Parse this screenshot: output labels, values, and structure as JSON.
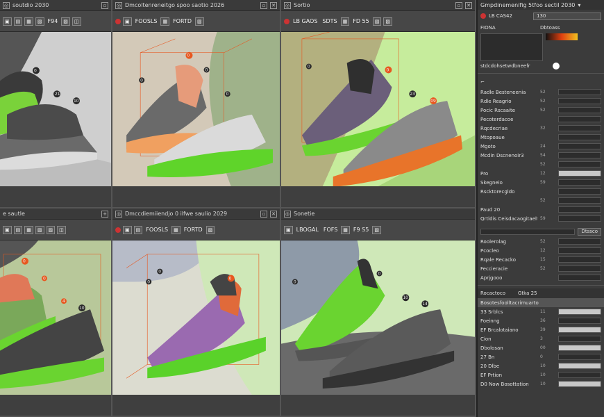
{
  "viewports": [
    {
      "title": "soutdio 2030",
      "tools": [
        "",
        "",
        "",
        "",
        "F94",
        "",
        "",
        ""
      ]
    },
    {
      "title": "Dmcoltenreneitgo spoo  saotio 2026",
      "tools": [
        "",
        "FOOSLS",
        "",
        "FORTD",
        ""
      ]
    },
    {
      "title": "Sortio",
      "tools": [
        "",
        "LB GAOS",
        "",
        "SDTS",
        "",
        "FD 55",
        "",
        ""
      ]
    },
    {
      "title": "e sautle",
      "tools": [
        "",
        "",
        "",
        "",
        "",
        "",
        "",
        ""
      ]
    },
    {
      "title": "Dmccdiemiiendjo 0 ilfwe  saulio 2029",
      "tools": [
        "",
        "",
        "",
        "FOOSLS",
        "",
        "FORTD",
        ""
      ]
    },
    {
      "title": "Sonetie",
      "tools": [
        "",
        "LBOGAL",
        "",
        "FOFS",
        "",
        "F9 S5",
        "",
        ""
      ]
    }
  ],
  "markers": {
    "v1": [
      "0",
      "21",
      "10"
    ],
    "v2": [
      "0",
      "0",
      "0",
      "0"
    ],
    "v3": [
      "0",
      "0",
      "23",
      "09"
    ],
    "v4": [
      "0",
      "0",
      "4",
      "10"
    ],
    "v5": [
      "0",
      "0",
      "0"
    ],
    "v6": [
      "0",
      "0",
      "10",
      "14"
    ]
  },
  "panel": {
    "title": "Gmpdinemenifig 5tfoo  sectil 2030",
    "top_label_1": "LB CAS42",
    "top_value": "130",
    "top_label_2": "FIONA",
    "top_label_3": "Dbtoass",
    "row_small": "stdcdohsetwdbneefr",
    "section1": [
      {
        "label": "Radle Besteneenia",
        "val": "52"
      },
      {
        "label": "Rdle Reagrio",
        "val": "52"
      },
      {
        "label": "Pocic Rscaaite",
        "val": "52"
      },
      {
        "label": "Pecoterdacoe",
        "val": ""
      },
      {
        "label": "Rqcdecriae",
        "val": "32"
      },
      {
        "label": "Mtopoaue",
        "val": ""
      },
      {
        "label": "Mgoto",
        "val": "24"
      },
      {
        "label": "Mcdin Dscnenoir3",
        "val": "54"
      },
      {
        "label": "",
        "val": "52"
      },
      {
        "label": "Pro",
        "val": "12"
      },
      {
        "label": "Skegneio",
        "val": "59"
      },
      {
        "label": "Rscktorecgldo",
        "val": ""
      },
      {
        "label": "",
        "val": "52"
      },
      {
        "label": "Paud 20",
        "val": ""
      },
      {
        "label": "Qrtldis Ceisdacaogitaelte",
        "val": "59"
      }
    ],
    "bar_label": "Dtssco",
    "section2": [
      {
        "label": "Roolerolag",
        "val": "52"
      },
      {
        "label": "Pcocleo",
        "val": "12"
      },
      {
        "label": "Rqale Recacko",
        "val": "15"
      },
      {
        "label": "Feccieracie",
        "val": "52"
      },
      {
        "label": "Aprjgooo",
        "val": ""
      }
    ],
    "table_header_1": "Rocactoco",
    "table_header_2": "Gtka 25",
    "table_title_row": "Bosotesfoolltacrimuarto",
    "table": [
      {
        "label": "33 Srblcs",
        "val": "11"
      },
      {
        "label": "Foeinng",
        "val": "36"
      },
      {
        "label": "EF Brcalotaiano",
        "val": "39"
      },
      {
        "label": "Cion",
        "val": "3"
      },
      {
        "label": "Dbolosan",
        "val": "00"
      },
      {
        "label": "27 Bn",
        "val": "0"
      },
      {
        "label": "20 Dlbe",
        "val": "10"
      },
      {
        "label": "EF Prtion",
        "val": "10"
      },
      {
        "label": "D0 Now Bosottation",
        "val": "10"
      }
    ]
  }
}
